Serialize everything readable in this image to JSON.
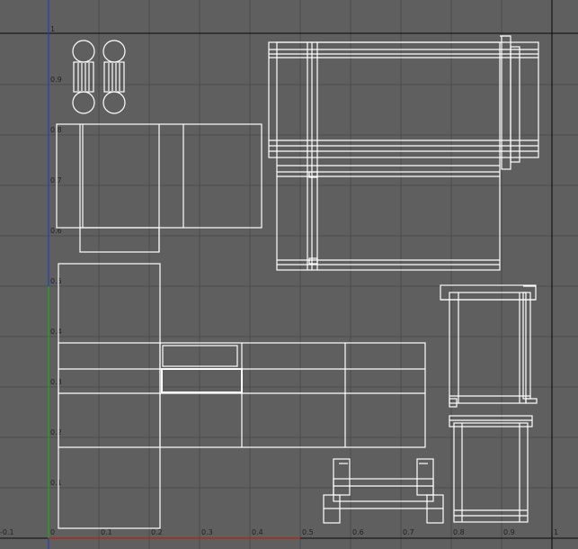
{
  "viewport": {
    "name": "uv-editor-viewport",
    "colors": {
      "background": "#5f5f5f",
      "grid": "#4c4c4c",
      "border": "#1a1a1a",
      "axis_x": "#b03020",
      "axis_y": "#2a9a2a",
      "axis_v": "#2040c0",
      "wire": "#ffffff"
    }
  },
  "x_ticks": [
    "-0.1",
    "0",
    "0.1",
    "0.2",
    "0.3",
    "0.4",
    "0.5",
    "0.6",
    "0.7",
    "0.8",
    "0.9",
    "1"
  ],
  "y_ticks": [
    "1",
    "0.9",
    "0.8",
    "0.7",
    "0.6",
    "0.5",
    "0.4",
    "0.3",
    "0.2",
    "0.1"
  ]
}
